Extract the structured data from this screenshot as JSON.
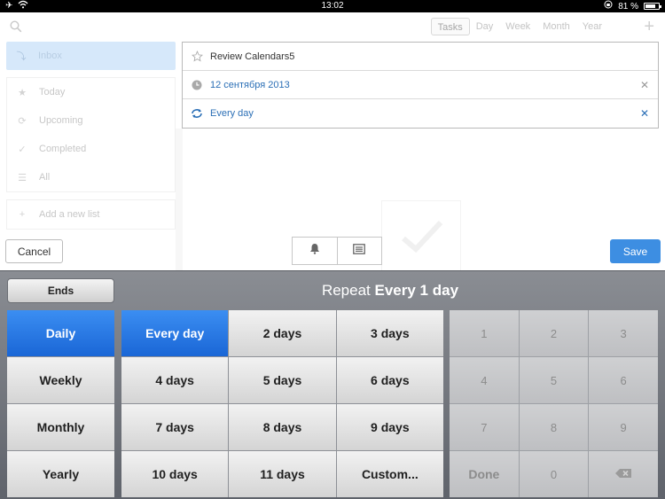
{
  "status_bar": {
    "time": "13:02",
    "battery": "81 %",
    "battery_fraction": 0.81
  },
  "toolbar": {
    "view_tabs": [
      "Tasks",
      "Day",
      "Week",
      "Month",
      "Year"
    ],
    "active_tab": "Tasks"
  },
  "sidebar": {
    "inbox": "Inbox",
    "items": [
      "Today",
      "Upcoming",
      "Completed",
      "All"
    ],
    "add_list": "Add a new list"
  },
  "task": {
    "title": "Review Calendars5",
    "date": "12 сентября 2013",
    "repeat": "Every day"
  },
  "buttons": {
    "cancel": "Cancel",
    "save": "Save",
    "ends": "Ends"
  },
  "picker": {
    "title_prefix": "Repeat",
    "title_value": "Every 1 day",
    "frequencies": [
      "Daily",
      "Weekly",
      "Monthly",
      "Yearly"
    ],
    "selected_frequency": "Daily",
    "intervals": [
      "Every day",
      "2 days",
      "3 days",
      "4 days",
      "5 days",
      "6 days",
      "7 days",
      "8 days",
      "9 days",
      "10 days",
      "11 days",
      "Custom..."
    ],
    "selected_interval": "Every day",
    "keypad": [
      "1",
      "2",
      "3",
      "4",
      "5",
      "6",
      "7",
      "8",
      "9",
      "Done",
      "0"
    ]
  },
  "colors": {
    "accent": "#3d8ee2",
    "link_blue": "#2b6fb6",
    "selected_cell": "#1a66d6"
  }
}
